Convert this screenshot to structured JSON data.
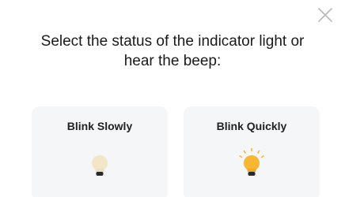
{
  "dialog": {
    "title_line1": "Select the status of the indicator light or",
    "title_line2": "hear the beep:",
    "close_icon": "close-icon"
  },
  "options": [
    {
      "label": "Blink Slowly",
      "icon": "bulb-dim-icon",
      "color": "#f3e6c8"
    },
    {
      "label": "Blink Quickly",
      "icon": "bulb-bright-icon",
      "color": "#f7b733"
    }
  ]
}
